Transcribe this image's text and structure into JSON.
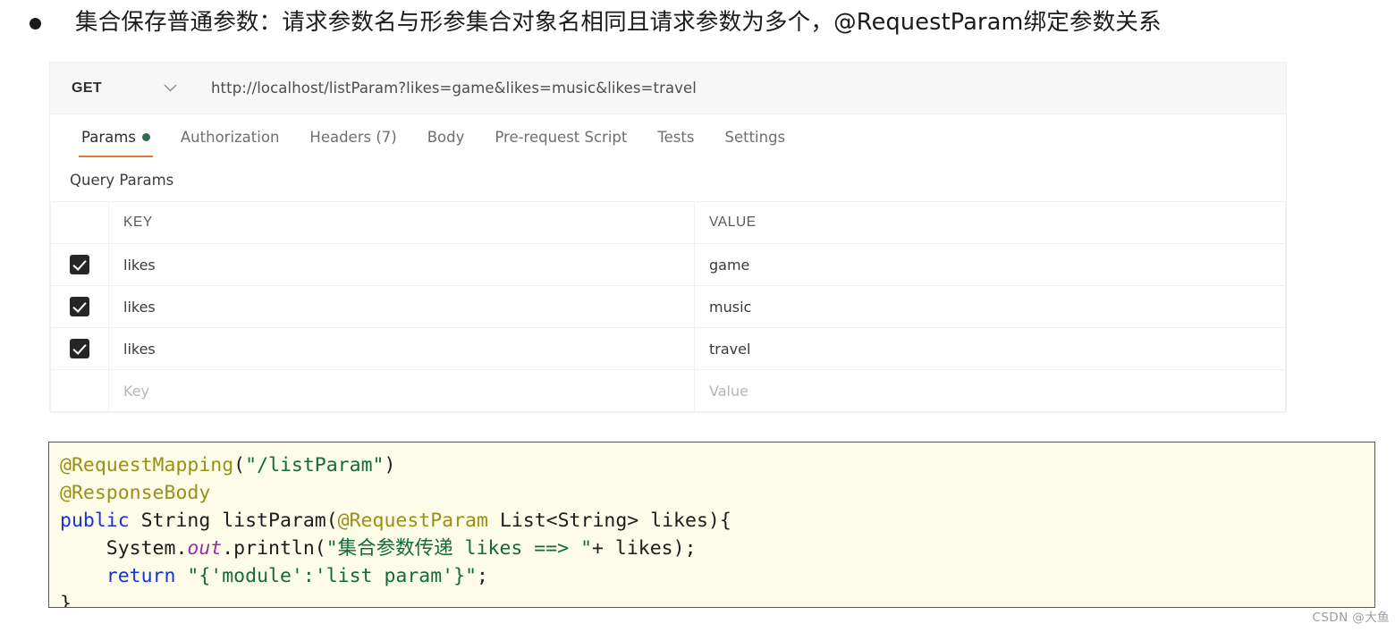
{
  "heading": {
    "bullet_text": "集合保存普通参数：请求参数名与形参集合对象名相同且请求参数为多个，@RequestParam绑定参数关系"
  },
  "postman": {
    "method": "GET",
    "method_chevron": "chevron-down-icon",
    "url": "http://localhost/listParam?likes=game&likes=music&likes=travel",
    "tabs": [
      {
        "label": "Params",
        "active": true,
        "has_dot": true
      },
      {
        "label": "Authorization",
        "active": false,
        "has_dot": false
      },
      {
        "label": "Headers (7)",
        "active": false,
        "has_dot": false
      },
      {
        "label": "Body",
        "active": false,
        "has_dot": false
      },
      {
        "label": "Pre-request Script",
        "active": false,
        "has_dot": false
      },
      {
        "label": "Tests",
        "active": false,
        "has_dot": false
      },
      {
        "label": "Settings",
        "active": false,
        "has_dot": false
      }
    ],
    "section_label": "Query Params",
    "table": {
      "headers": {
        "key": "KEY",
        "value": "VALUE"
      },
      "rows": [
        {
          "checked": true,
          "key": "likes",
          "value": "game"
        },
        {
          "checked": true,
          "key": "likes",
          "value": "music"
        },
        {
          "checked": true,
          "key": "likes",
          "value": "travel"
        }
      ],
      "empty_row": {
        "key_placeholder": "Key",
        "value_placeholder": "Value"
      }
    },
    "colors": {
      "accent_underline": "#e07b39",
      "status_dot": "#2c6e4f"
    }
  },
  "code": {
    "language": "java",
    "lines": [
      [
        {
          "t": "@RequestMapping",
          "c": "ann"
        },
        {
          "t": "(",
          "c": "plain"
        },
        {
          "t": "\"/listParam\"",
          "c": "str"
        },
        {
          "t": ")",
          "c": "plain"
        }
      ],
      [
        {
          "t": "@ResponseBody",
          "c": "ann"
        }
      ],
      [
        {
          "t": "public",
          "c": "kw"
        },
        {
          "t": " String listParam(",
          "c": "plain"
        },
        {
          "t": "@RequestParam",
          "c": "ann"
        },
        {
          "t": " List<String> likes){",
          "c": "plain"
        }
      ],
      [
        {
          "t": "    System.",
          "c": "plain"
        },
        {
          "t": "out",
          "c": "field"
        },
        {
          "t": ".println(",
          "c": "plain"
        },
        {
          "t": "\"集合参数传递 likes ==> \"",
          "c": "str"
        },
        {
          "t": "+ likes);",
          "c": "plain"
        }
      ],
      [
        {
          "t": "    ",
          "c": "plain"
        },
        {
          "t": "return",
          "c": "kw"
        },
        {
          "t": " ",
          "c": "plain"
        },
        {
          "t": "\"{'module':'list param'}\"",
          "c": "str"
        },
        {
          "t": ";",
          "c": "plain"
        }
      ],
      [
        {
          "t": "}",
          "c": "plain"
        }
      ]
    ],
    "colors": {
      "background": "#fcfce9",
      "border": "#57575e",
      "annotation": "#9b9017",
      "keyword": "#1832d8",
      "string": "#136a3a",
      "field": "#9b2fa8"
    }
  },
  "watermark": {
    "text": "CSDN @大鱼"
  }
}
